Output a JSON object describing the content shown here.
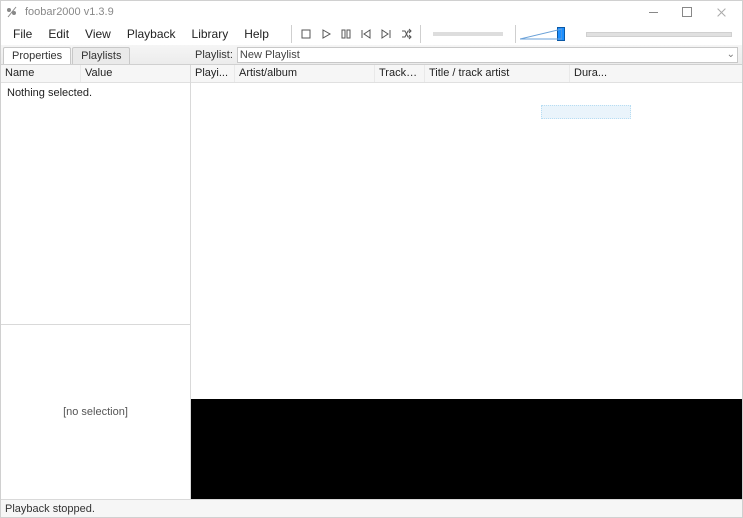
{
  "title": "foobar2000 v1.3.9",
  "window_controls": {
    "min": "minimize",
    "max": "maximize",
    "close": "close"
  },
  "menu": [
    "File",
    "Edit",
    "View",
    "Playback",
    "Library",
    "Help"
  ],
  "tabs_left": {
    "active": "Properties",
    "other": "Playlists"
  },
  "properties": {
    "columns": {
      "name": "Name",
      "value": "Value"
    },
    "body_text": "Nothing selected.",
    "no_selection_label": "[no selection]"
  },
  "playlist_row": {
    "label": "Playlist:",
    "current": "New Playlist"
  },
  "list_columns": {
    "playing": "Playi...",
    "artist_album": "Artist/album",
    "track_no": "Track no",
    "title": "Title / track artist",
    "duration": "Dura..."
  },
  "status": "Playback stopped.",
  "volume": {
    "level_pct": 100
  },
  "icons": {
    "stop": "stop-icon",
    "play": "play-icon",
    "pause": "pause-icon",
    "prev": "prev-icon",
    "next": "next-icon",
    "random": "random-icon"
  }
}
